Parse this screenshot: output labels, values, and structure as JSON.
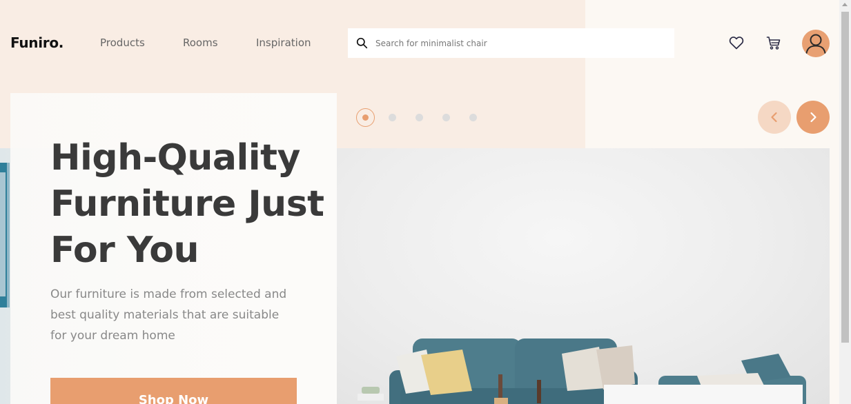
{
  "header": {
    "logo": "Funiro.",
    "nav": [
      {
        "label": "Products"
      },
      {
        "label": "Rooms"
      },
      {
        "label": "Inspiration"
      }
    ],
    "search": {
      "placeholder": "Search for minimalist chair",
      "value": "",
      "icon": "search-icon"
    },
    "icons": [
      "heart-icon",
      "cart-icon",
      "user-avatar"
    ]
  },
  "hero": {
    "title": "High-Quality Furniture Just For You",
    "description": "Our furniture is made from selected and best quality materials that are suitable for your dream home",
    "cta_label": "Shop Now"
  },
  "carousel": {
    "slide_count": 5,
    "active_index": 0,
    "prev_icon": "chevron-left-icon",
    "next_icon": "chevron-right-icon"
  },
  "colors": {
    "accent": "#E89E6F",
    "accent_light": "#F5D8C4",
    "peach_bg": "#F9EDE4",
    "cream_bg": "#FCF8F3",
    "text_dark": "#3A3A3A",
    "text_muted": "#888888"
  }
}
